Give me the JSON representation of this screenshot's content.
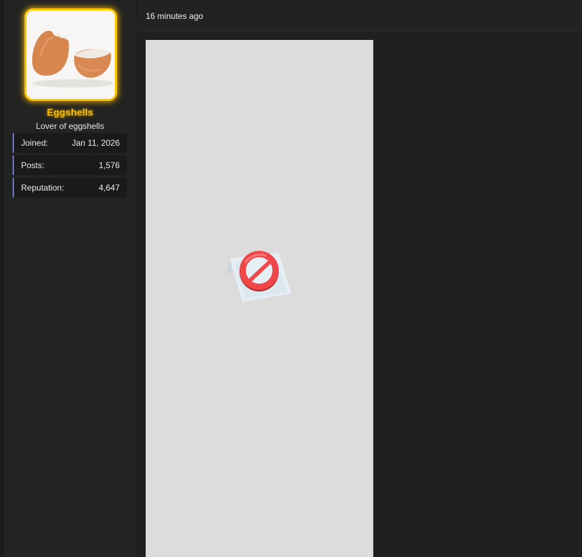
{
  "post": {
    "timestamp": "16 minutes ago"
  },
  "user": {
    "name": "Eggshells",
    "title": "Lover of eggshells",
    "name_color": "#ffbf00",
    "avatar_border_color": "#ffc800",
    "stats": [
      {
        "label": "Joined:",
        "value": "Jan 11, 2026"
      },
      {
        "label": "Posts:",
        "value": "1,576"
      },
      {
        "label": "Reputation:",
        "value": "4,647"
      }
    ]
  },
  "content": {
    "image_state": "blocked",
    "icon": "prohibited-icon",
    "icon_color": "#f0474a"
  }
}
